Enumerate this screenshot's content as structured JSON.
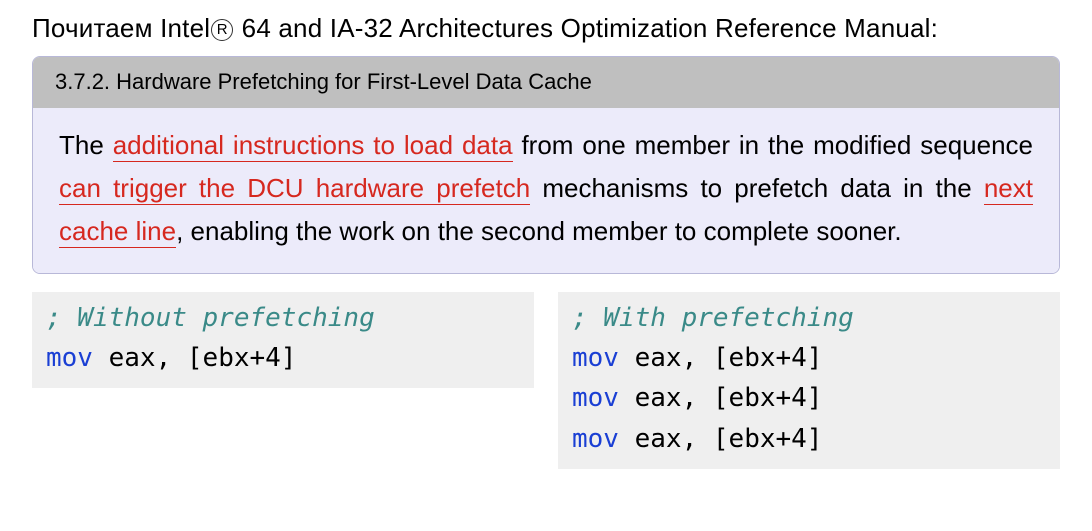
{
  "intro": {
    "prefix": "Почитаем Intel",
    "registered": "R",
    "suffix": " 64 and IA-32 Architectures Optimization Reference Manual:"
  },
  "quote": {
    "header": "3.7.2. Hardware Prefetching for First-Level Data Cache",
    "body": {
      "t1": "The ",
      "h1": "additional instructions to load data",
      "t2": " from one member in the modified sequence ",
      "h2": "can trigger the DCU hardware prefetch",
      "t3": " mechanisms to prefetch data in the ",
      "h3": "next cache line",
      "t4": ", enabling the work on the second member to complete sooner."
    }
  },
  "code": {
    "left": {
      "comment": "; Without prefetching",
      "lines": [
        {
          "mn": "mov",
          "args": " eax, [ebx+4]"
        }
      ]
    },
    "right": {
      "comment": "; With prefetching",
      "lines": [
        {
          "mn": "mov",
          "args": " eax, [ebx+4]"
        },
        {
          "mn": "mov",
          "args": " eax, [ebx+4]"
        },
        {
          "mn": "mov",
          "args": " eax, [ebx+4]"
        }
      ]
    }
  }
}
